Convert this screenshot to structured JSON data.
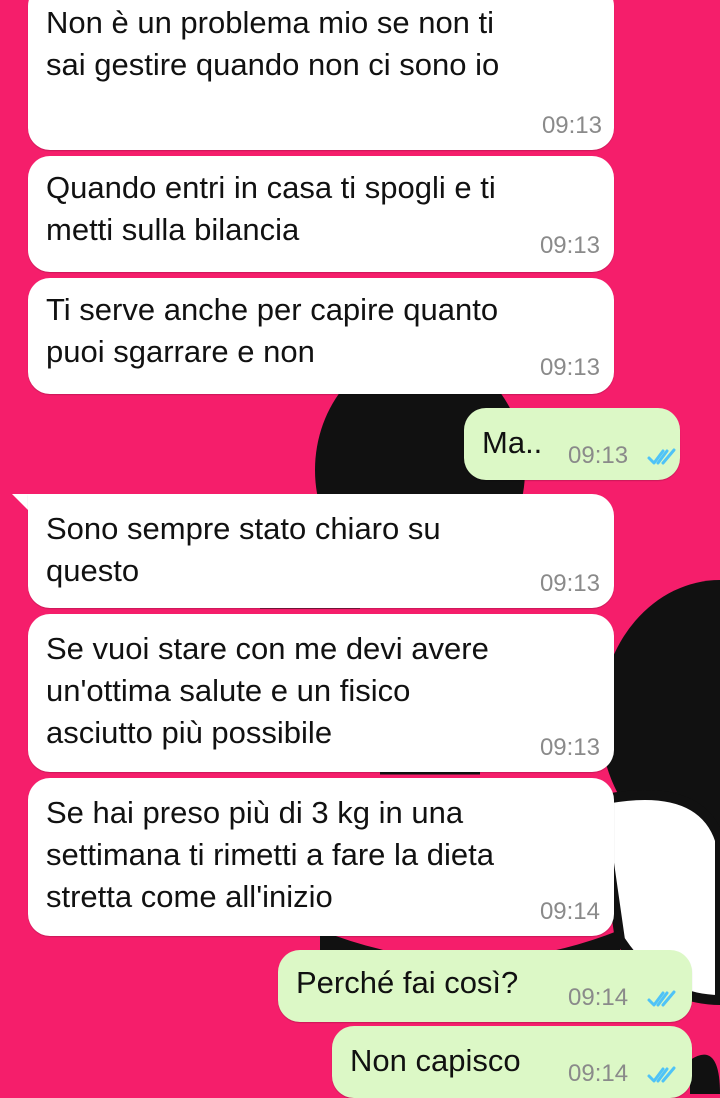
{
  "messages": [
    {
      "direction": "in",
      "text": "Non è un problema mio se non ti\nsai gestire quando non ci sono io",
      "time": "09:13"
    },
    {
      "direction": "in",
      "text": "Quando entri in casa ti spogli e ti\nmetti sulla bilancia",
      "time": "09:13"
    },
    {
      "direction": "in",
      "text": "Ti serve anche per capire quanto\npuoi sgarrare e non",
      "time": "09:13"
    },
    {
      "direction": "out",
      "text": "Ma..",
      "time": "09:13",
      "status": "read"
    },
    {
      "direction": "in",
      "text": "Sono sempre stato chiaro su\nquesto",
      "time": "09:13"
    },
    {
      "direction": "in",
      "text": "Se vuoi stare con me devi avere\nun'ottima salute e un fisico\nasciutto più possibile",
      "time": "09:13"
    },
    {
      "direction": "in",
      "text": "Se hai preso più di 3 kg in una\nsettimana ti rimetti a fare la dieta\nstretta come all'inizio",
      "time": "09:14"
    },
    {
      "direction": "out",
      "text": "Perché fai così?",
      "time": "09:14",
      "status": "read"
    },
    {
      "direction": "out",
      "text": "Non capisco",
      "time": "09:14",
      "status": "read"
    }
  ],
  "colors": {
    "wallpaper": "#f51e6b",
    "incoming_bubble": "#ffffff",
    "outgoing_bubble": "#dcf8c6",
    "read_ticks": "#4fc3f7",
    "timestamp": "#8a8a8a"
  },
  "icons": {
    "read_receipt": "double-check-icon"
  }
}
